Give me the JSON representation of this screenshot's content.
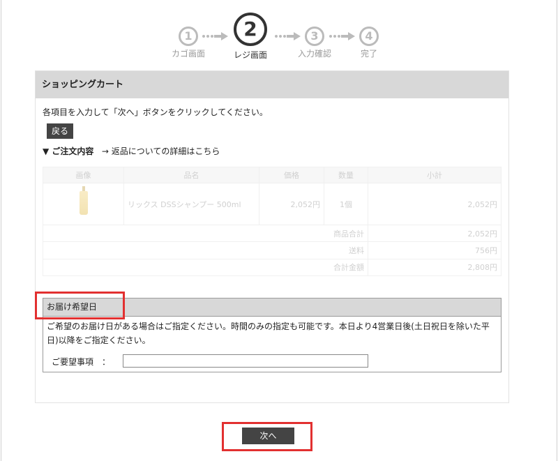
{
  "steps": [
    {
      "num": "1",
      "label": "カゴ画面"
    },
    {
      "num": "2",
      "label": "レジ画面"
    },
    {
      "num": "3",
      "label": "入力確認"
    },
    {
      "num": "4",
      "label": "完了"
    }
  ],
  "cart": {
    "title": "ショッピングカート",
    "instruction": "各項目を入力して「次へ」ボタンをクリックしてください。",
    "back_label": "戻る",
    "order_heading": "▼ ご注文内容",
    "returns_link": "→ 返品についての詳細はこちら",
    "table": {
      "headers": [
        "画像",
        "品名",
        "価格",
        "数量",
        "小計"
      ],
      "item": {
        "name": "リックス DSSシャンプー 500ml",
        "price": "2,052円",
        "qty": "1個",
        "subtotal": "2,052円"
      },
      "totals": [
        {
          "label": "商品合計",
          "value": "2,052円"
        },
        {
          "label": "送料",
          "value": "756円"
        },
        {
          "label": "合計金額",
          "value": "2,808円"
        }
      ]
    }
  },
  "delivery": {
    "title": "お届け希望日",
    "text": "ご希望のお届け日がある場合はご指定ください。時間のみの指定も可能です。本日より4営業日後(土日祝日を除いた平日)以降をご指定ください。",
    "request_label": "ご要望事項　：",
    "request_value": ""
  },
  "next_label": "次へ",
  "colors": {
    "highlight": "#e23030",
    "button": "#444444",
    "header_bg": "#d8d8d8"
  }
}
